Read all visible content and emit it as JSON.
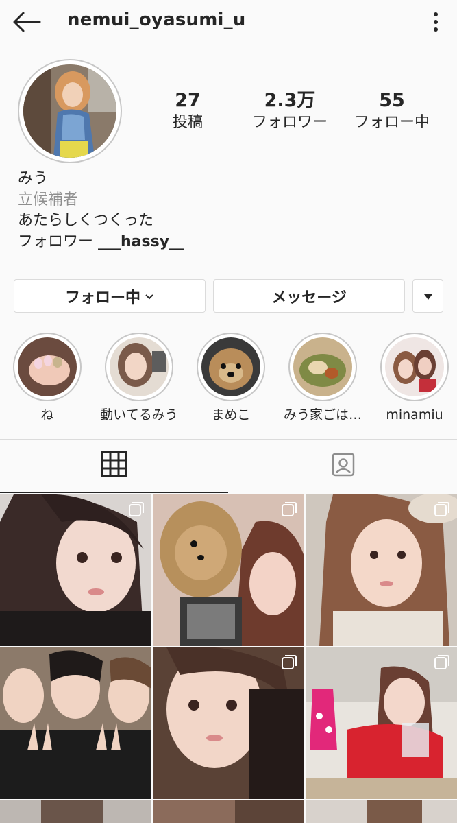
{
  "header": {
    "username": "nemui_oyasumi_u",
    "back_icon": "arrow-left-icon",
    "menu_icon": "vertical-dots-icon"
  },
  "stats": {
    "posts": {
      "count": "27",
      "label": "投稿"
    },
    "followers": {
      "count": "2.3万",
      "label": "フォロワー"
    },
    "following": {
      "count": "55",
      "label": "フォロー中"
    }
  },
  "bio": {
    "name": "みう",
    "category": "立候補者",
    "line1": "あたらしくつくった",
    "line2_prefix": "フォロワー ",
    "mention": "___hassy__"
  },
  "buttons": {
    "follow": "フォロー中",
    "message": "メッセージ",
    "more_icon": "triangle-down-icon"
  },
  "highlights": [
    {
      "label": "ね"
    },
    {
      "label": "動いてるみう"
    },
    {
      "label": "まめこ"
    },
    {
      "label": "みう家ごは…"
    },
    {
      "label": "minamiu"
    }
  ],
  "tabs": {
    "grid_icon": "grid-icon",
    "tagged_icon": "tagged-person-icon"
  },
  "colors": {
    "background": "#fafafa",
    "text": "#262626",
    "secondary": "#8e8e8e",
    "border": "#dbdbdb"
  }
}
